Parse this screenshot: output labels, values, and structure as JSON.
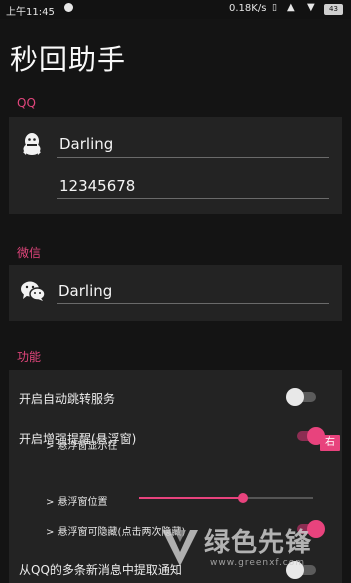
{
  "status_bar": {
    "time": "上午11:45",
    "network_speed": "0.18K/s",
    "battery": "43",
    "icons": [
      "notification-icon",
      "vibrate-icon",
      "signal-icon",
      "wifi-icon",
      "battery-icon"
    ]
  },
  "app": {
    "title": "秒回助手"
  },
  "qq": {
    "section_label": "QQ",
    "name_value": "Darling",
    "number_value": "12345678",
    "icon": "qq-penguin-icon"
  },
  "wechat": {
    "section_label": "微信",
    "name_value": "Darling",
    "icon": "wechat-icon"
  },
  "features": {
    "section_label": "功能",
    "auto_jump": {
      "label": "开启自动跳转服务",
      "enabled": false
    },
    "enhanced_reminder": {
      "label": "开启增强提醒(悬浮窗)",
      "enabled": true
    },
    "float_display": {
      "label": "> 悬浮窗显示在",
      "button_label": "右"
    },
    "float_position": {
      "label": "> 悬浮窗位置",
      "value_fraction": 0.6
    },
    "float_hideable": {
      "label": "> 悬浮窗可隐藏(点击两次隐藏)",
      "enabled": true
    },
    "extract_notification": {
      "label": "从QQ的多条新消息中提取通知",
      "enabled": false
    }
  },
  "watermark": {
    "text": "绿色先锋",
    "url": "www.greenxf.com"
  },
  "colors": {
    "accent": "#e8437d",
    "background": "#141414",
    "card": "#232323"
  }
}
